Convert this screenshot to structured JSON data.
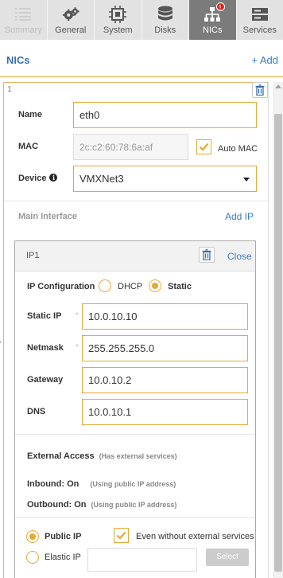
{
  "tabs": [
    {
      "label": "Summary",
      "icon": "summary-icon",
      "state": "disabled"
    },
    {
      "label": "General",
      "icon": "gears-icon",
      "state": "normal"
    },
    {
      "label": "System",
      "icon": "chip-icon",
      "state": "normal"
    },
    {
      "label": "Disks",
      "icon": "database-icon",
      "state": "normal"
    },
    {
      "label": "NICs",
      "icon": "network-icon",
      "state": "active",
      "badge": "!"
    },
    {
      "label": "Services",
      "icon": "services-icon",
      "state": "normal"
    }
  ],
  "header": {
    "title": "NICs",
    "add_label": "+ Add"
  },
  "nic": {
    "index": "1",
    "name_label": "Name",
    "name_value": "eth0",
    "mac_label": "MAC",
    "mac_value": "2c:c2:60:78:6a:af",
    "auto_mac_label": "Auto MAC",
    "auto_mac_checked": true,
    "device_label": "Device",
    "device_value": "VMXNet3",
    "main_interface_label": "Main Interface",
    "add_ip_label": "Add IP"
  },
  "ip": {
    "title": "IP1",
    "close_label": "Close",
    "config_label": "IP Configuration",
    "dhcp_label": "DHCP",
    "static_label": "Static",
    "selected_mode": "static",
    "static_ip_label": "Static IP",
    "static_ip_value": "10.0.10.10",
    "netmask_label": "Netmask",
    "netmask_value": "255.255.255.0",
    "gateway_label": "Gateway",
    "gateway_value": "10.0.10.2",
    "dns_label": "DNS",
    "dns_value": "10.0.10.1",
    "required_mark": "*"
  },
  "external": {
    "title": "External Access",
    "title_note": "(Has external services)",
    "inbound_label": "Inbound: On",
    "inbound_note": "(Using public IP address)",
    "outbound_label": "Outbound: On",
    "outbound_note": "(Using public IP address)",
    "public_ip_label": "Public IP",
    "even_without_label": "Even without external services",
    "even_without_checked": true,
    "elastic_ip_label": "Elastic IP",
    "select_label": "Select",
    "selected_option": "public"
  },
  "colors": {
    "accent": "#e8a835",
    "link": "#3a7bc8",
    "active_tab": "#7b7b7b",
    "badge": "#d62828"
  }
}
